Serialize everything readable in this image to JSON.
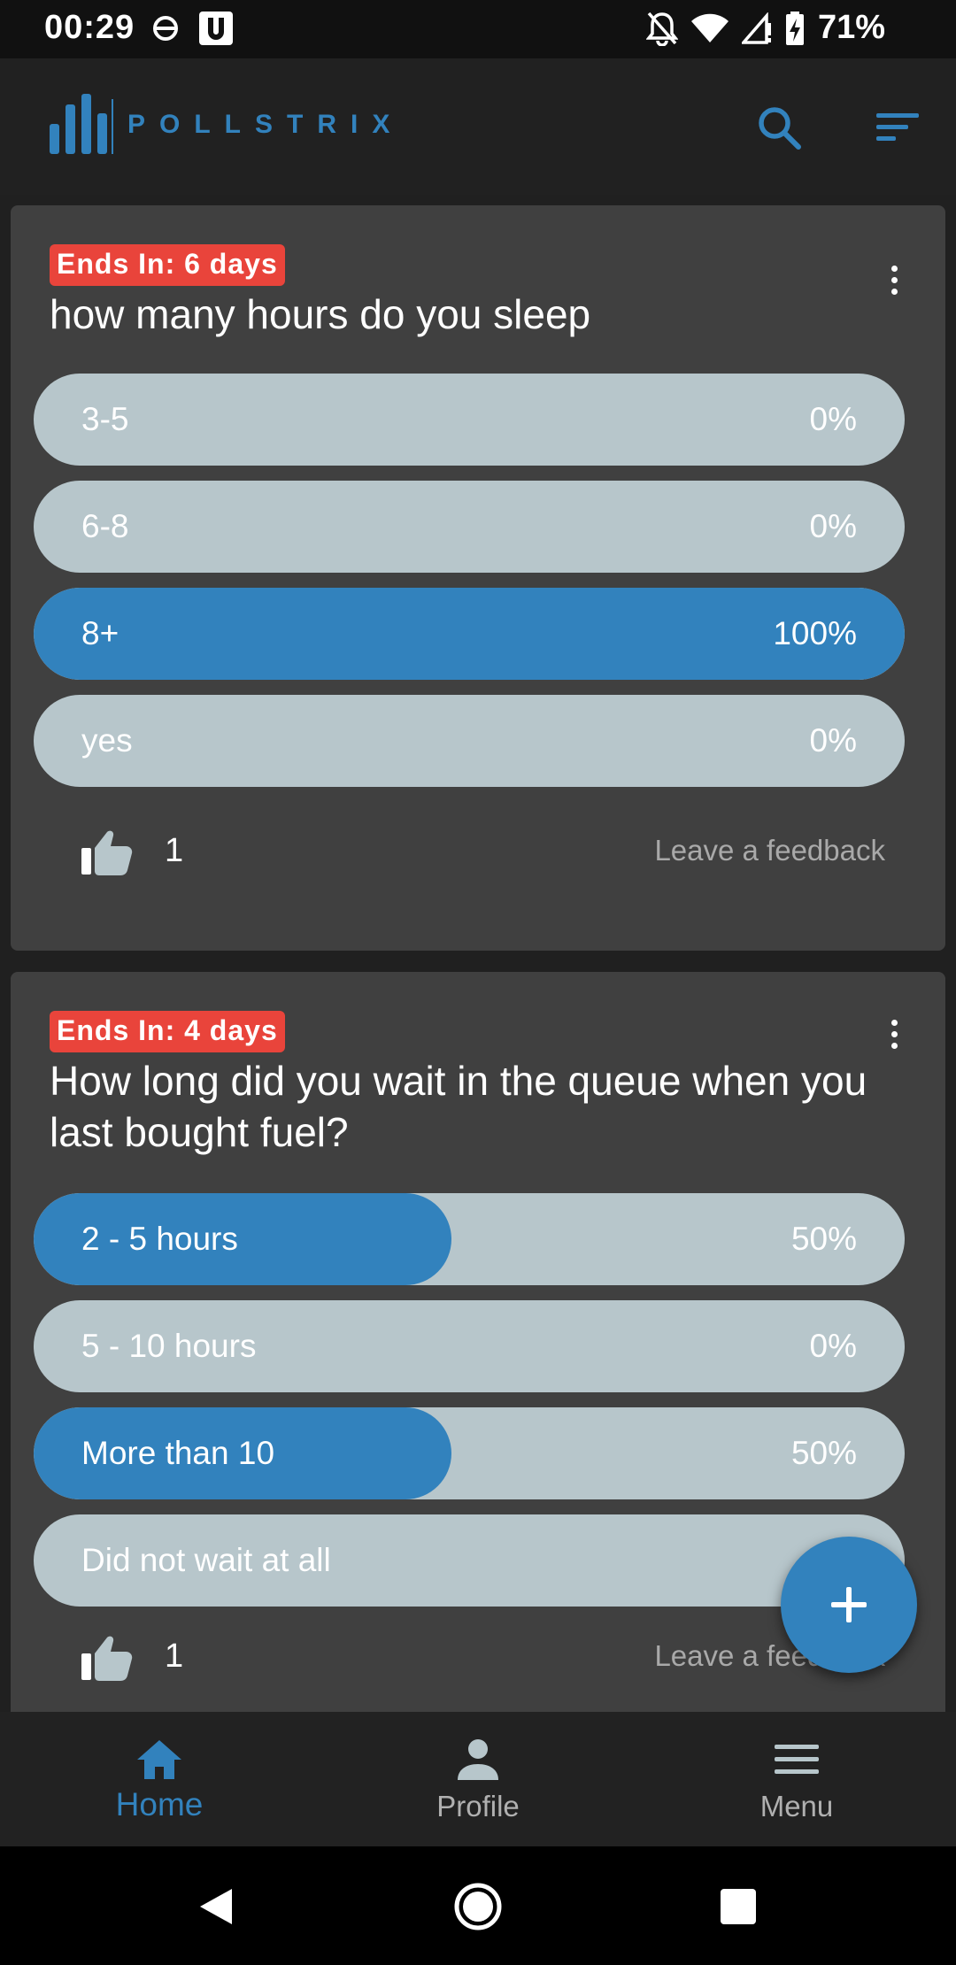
{
  "status_bar": {
    "time": "00:29",
    "battery": "71%"
  },
  "app": {
    "name": "POLLSTRIX",
    "accent_color": "#3282bd",
    "actions": [
      "search-icon",
      "sort-icon"
    ]
  },
  "polls": [
    {
      "ends_in": "Ends In: 6 days",
      "question": "how many hours do you sleep",
      "options": [
        {
          "label": "3-5",
          "percent_text": "0%",
          "percent": 0
        },
        {
          "label": "6-8",
          "percent_text": "0%",
          "percent": 0
        },
        {
          "label": "8+",
          "percent_text": "100%",
          "percent": 100
        },
        {
          "label": "yes",
          "percent_text": "0%",
          "percent": 0
        }
      ],
      "likes": "1",
      "feedback_label": "Leave a feedback"
    },
    {
      "ends_in": "Ends In: 4 days",
      "question": "How long did you wait in the queue when you last bought fuel?",
      "options": [
        {
          "label": "2 - 5 hours",
          "percent_text": "50%",
          "percent": 50
        },
        {
          "label": "5 - 10 hours",
          "percent_text": "0%",
          "percent": 0
        },
        {
          "label": "More than 10",
          "percent_text": "50%",
          "percent": 50
        },
        {
          "label": "Did not wait at all",
          "percent_text": "",
          "percent": 0
        }
      ],
      "likes": "1",
      "feedback_label": "Leave a feedback"
    }
  ],
  "fab": {
    "icon": "plus-icon"
  },
  "bottom_nav": {
    "items": [
      {
        "label": "Home",
        "icon": "home-icon",
        "active": true
      },
      {
        "label": "Profile",
        "icon": "person-icon",
        "active": false
      },
      {
        "label": "Menu",
        "icon": "menu-icon",
        "active": false
      }
    ]
  }
}
